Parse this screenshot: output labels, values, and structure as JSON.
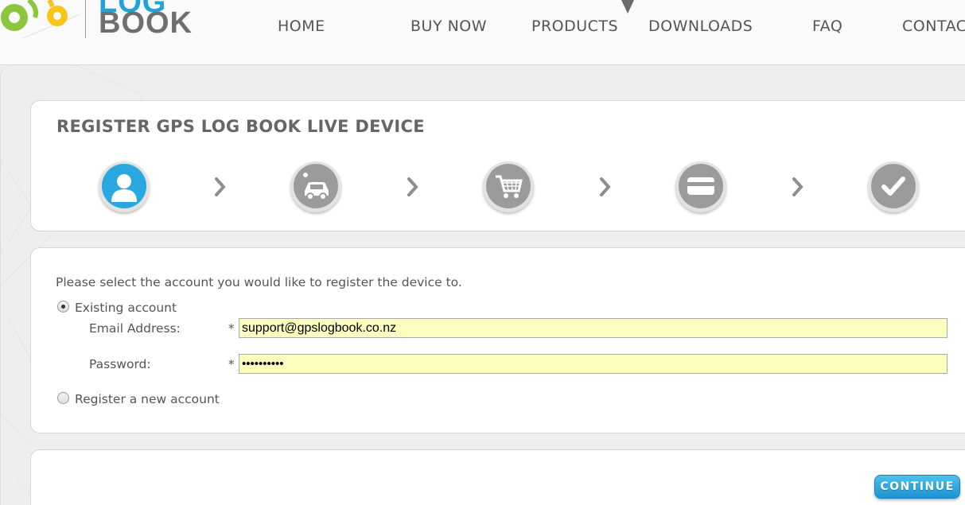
{
  "brand": {
    "logo_text_top": "LOG",
    "logo_text": "BOOK",
    "colors": {
      "green": "#8cc63f",
      "yellow": "#f7c51a",
      "blue": "#1fa3dc",
      "gray": "#6f6f6f"
    }
  },
  "nav": {
    "items": [
      {
        "label": "HOME"
      },
      {
        "label": "BUY NOW"
      },
      {
        "label": "PRODUCTS"
      },
      {
        "label": "DOWNLOADS"
      },
      {
        "label": "FAQ"
      },
      {
        "label": "CONTACT"
      }
    ]
  },
  "wizard": {
    "title": "REGISTER GPS LOG BOOK LIVE DEVICE",
    "steps": [
      {
        "icon": "user-icon",
        "active": true
      },
      {
        "icon": "add-vehicle-icon",
        "active": false
      },
      {
        "icon": "shopping-cart-icon",
        "active": false
      },
      {
        "icon": "credit-card-icon",
        "active": false
      },
      {
        "icon": "checkmark-icon",
        "active": false
      }
    ],
    "accent_color": "#29a8e0"
  },
  "form": {
    "intro": "Please select the account you would like to register the device to.",
    "existing_label": "Existing account",
    "existing_selected": true,
    "email_label": "Email Address:",
    "email_value": "support@gpslogbook.co.nz",
    "password_label": "Password:",
    "password_value": "••••••••••",
    "required_mark": "*",
    "new_account_label": "Register a new account"
  },
  "actions": {
    "continue_label": "CONTINUE"
  }
}
